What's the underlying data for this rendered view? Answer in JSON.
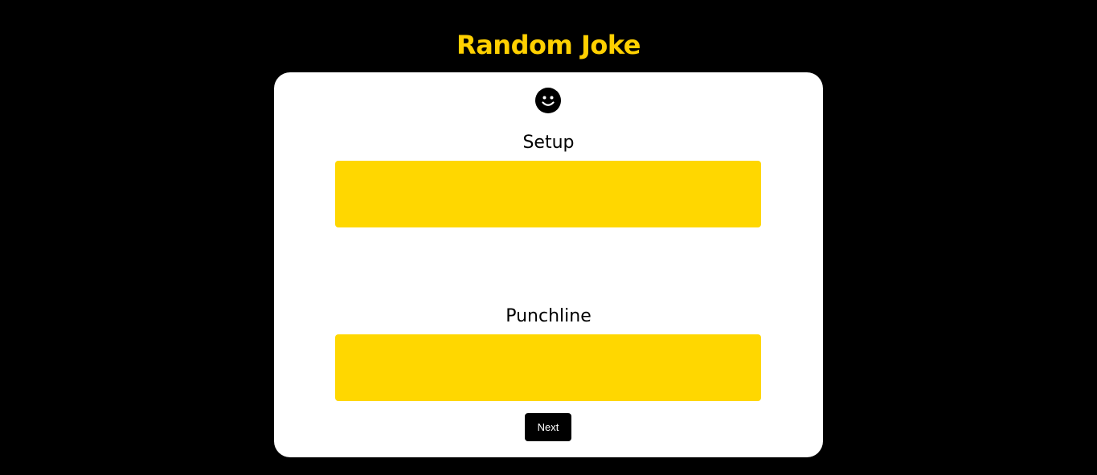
{
  "app": {
    "title": "Random Joke"
  },
  "card": {
    "icon": "smiley-face-icon",
    "setup_label": "Setup",
    "setup_text": "",
    "punchline_label": "Punchline",
    "punchline_text": "",
    "next_label": "Next"
  },
  "colors": {
    "background": "#000000",
    "accent": "#ffd000",
    "box_fill": "#ffd700",
    "card": "#ffffff",
    "button": "#000000",
    "button_text": "#ffffff"
  }
}
